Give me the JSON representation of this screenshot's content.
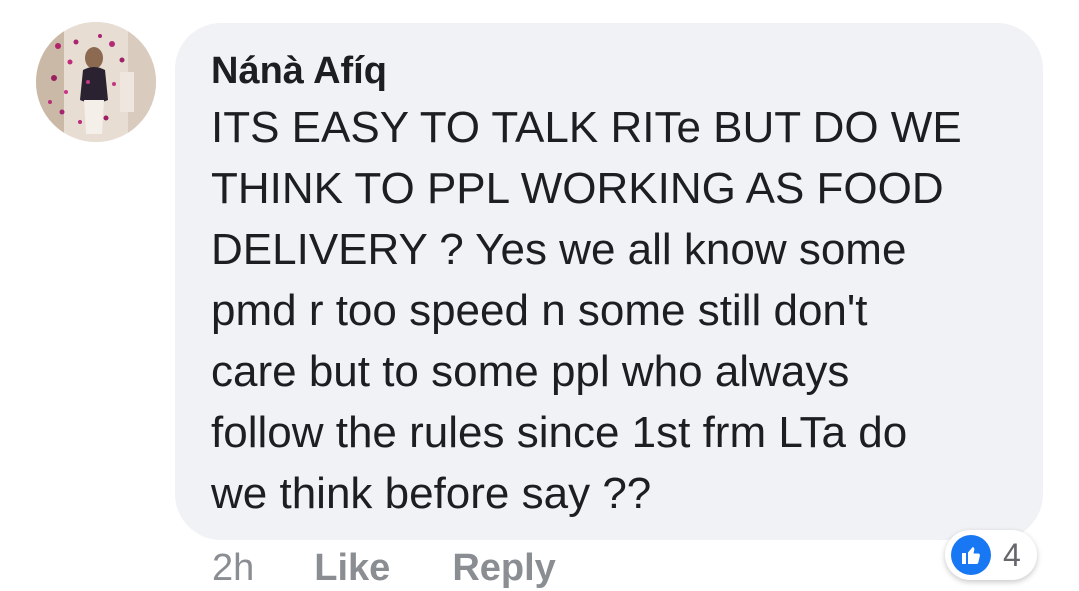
{
  "comment": {
    "author": "Nánà Afíq",
    "lines": [
      "ITS EASY TO TALK RITe BUT DO WE",
      "THINK TO PPL WORKING AS FOOD",
      "DELIVERY ? Yes we all know some",
      "pmd r too speed n some still don't",
      "care but to some ppl who always",
      "follow the rules since 1st frm LTa do",
      "we think before say ??"
    ]
  },
  "actions": {
    "timestamp": "2h",
    "like_label": "Like",
    "reply_label": "Reply"
  },
  "reactions": {
    "icon": "thumbs-up-icon",
    "count": "4",
    "color": "#1877f2"
  },
  "colors": {
    "bubble": "#f0f2f5",
    "text": "#1c1e21",
    "muted": "#8a8d91"
  }
}
